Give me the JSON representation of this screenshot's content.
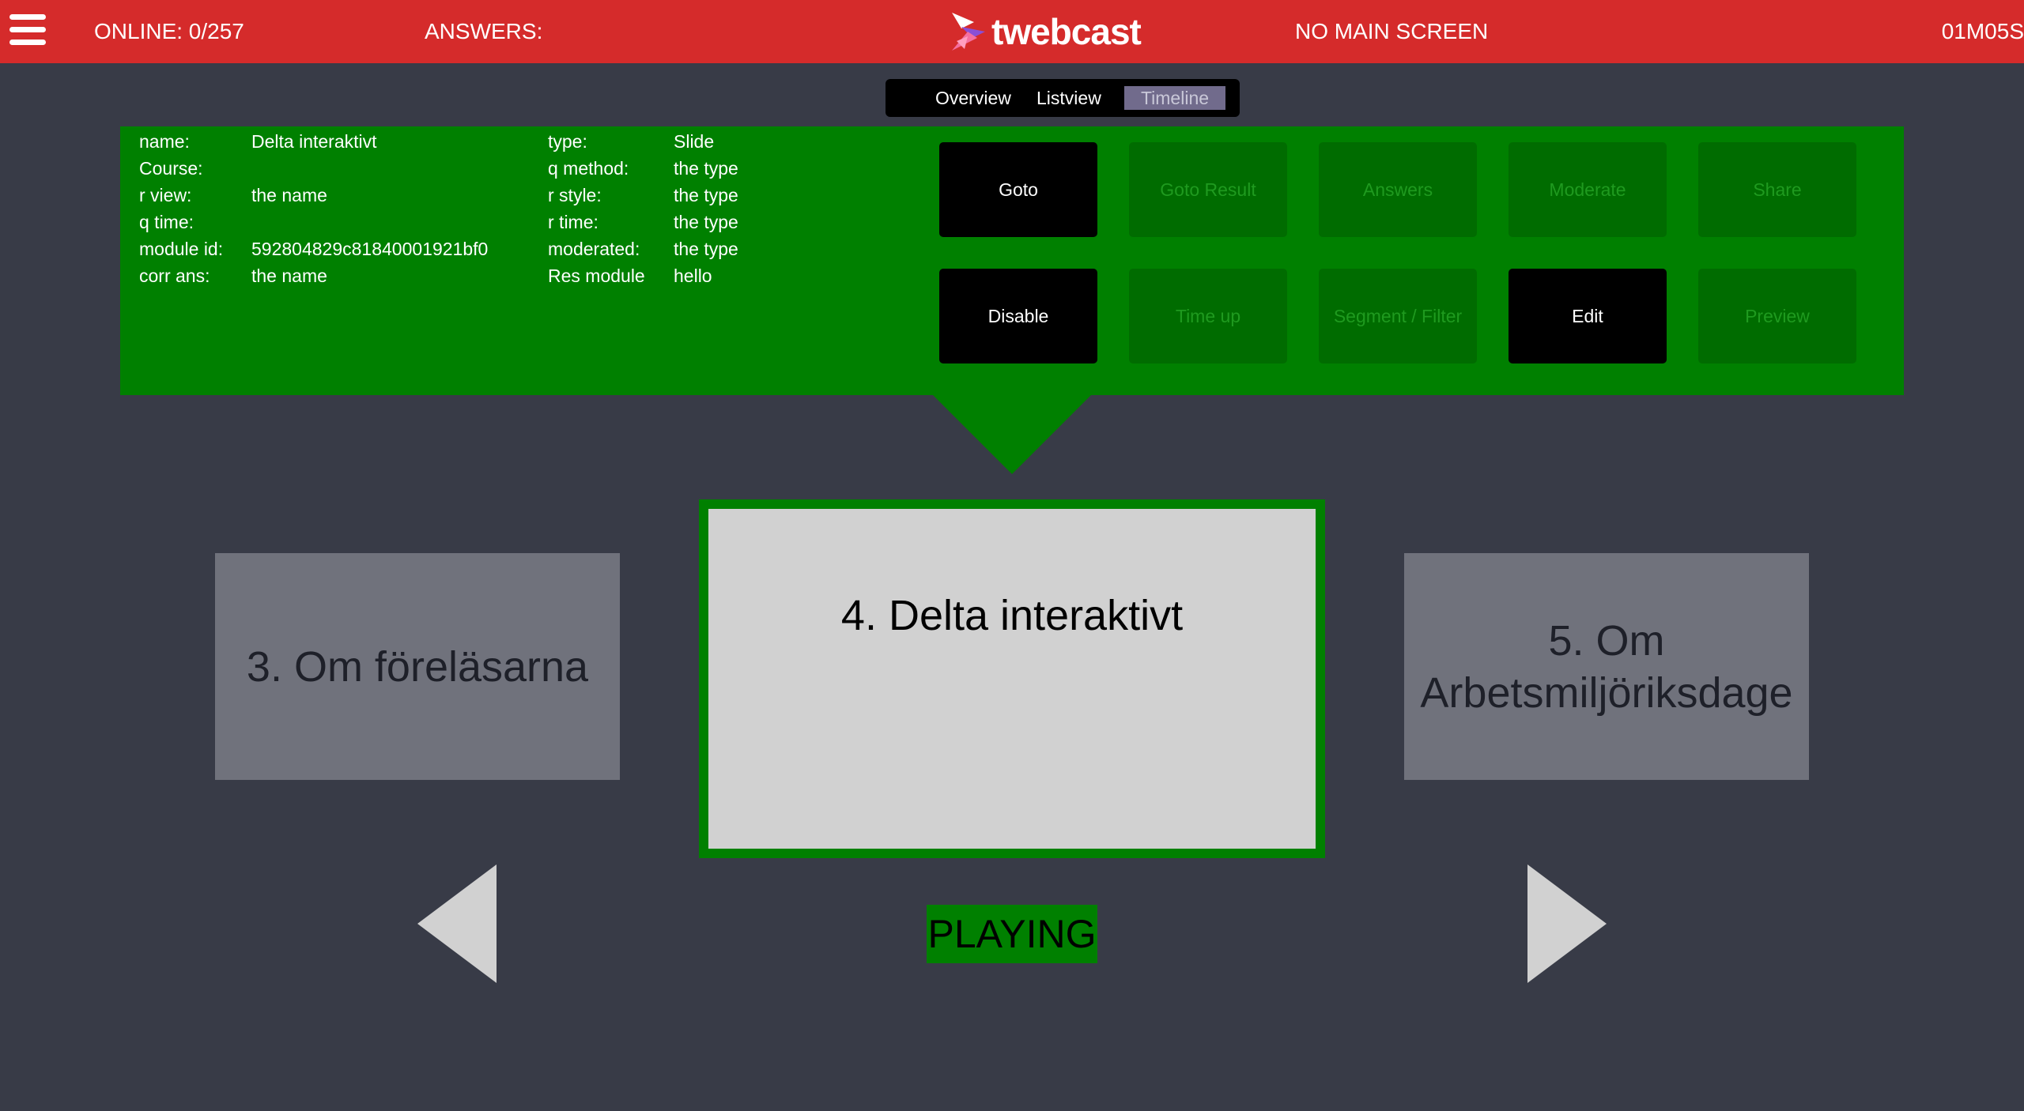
{
  "topbar": {
    "online": "ONLINE: 0/257",
    "answers": "ANSWERS:",
    "logo_text": "twebcast",
    "screen_status": "NO MAIN SCREEN",
    "timer": "01M05S"
  },
  "view_tabs": [
    {
      "label": "Overview"
    },
    {
      "label": "Listview"
    },
    {
      "label": "Timeline",
      "selected": true
    }
  ],
  "info": {
    "left": [
      {
        "key": "name:",
        "value": "Delta interaktivt"
      },
      {
        "key": "Course:",
        "value": ""
      },
      {
        "key": "r view:",
        "value": "the name"
      },
      {
        "key": "q time:",
        "value": ""
      },
      {
        "key": "module id:",
        "value": "592804829c81840001921bf0"
      },
      {
        "key": "corr ans:",
        "value": "the name"
      }
    ],
    "right": [
      {
        "key": "type:",
        "value": "Slide"
      },
      {
        "key": "q method:",
        "value": "the type"
      },
      {
        "key": "r style:",
        "value": "the type"
      },
      {
        "key": "r time:",
        "value": "the type"
      },
      {
        "key": "moderated:",
        "value": "the type"
      },
      {
        "key": "Res module",
        "value": "hello"
      }
    ]
  },
  "actions": {
    "row1": [
      {
        "label": "Goto",
        "enabled": true
      },
      {
        "label": "Goto Result",
        "enabled": false
      },
      {
        "label": "Answers",
        "enabled": false
      },
      {
        "label": "Moderate",
        "enabled": false
      },
      {
        "label": "Share",
        "enabled": false
      }
    ],
    "row2": [
      {
        "label": "Disable",
        "enabled": true
      },
      {
        "label": "Time up",
        "enabled": false
      },
      {
        "label": "Segment / Filter",
        "enabled": false
      },
      {
        "label": "Edit",
        "enabled": true
      },
      {
        "label": "Preview",
        "enabled": false
      }
    ]
  },
  "timeline": {
    "prev": {
      "title": "3. Om föreläsarna"
    },
    "current": {
      "title": "4. Delta interaktivt"
    },
    "next": {
      "title": "5. Om Arbetsmiljöriksdage"
    }
  },
  "status": "PLAYING",
  "colors": {
    "topbar": "#d52b2b",
    "background": "#383b47",
    "panel_green": "#008000",
    "inactive_button": "#006c00",
    "active_button": "#000000",
    "side_slide": "#70727c",
    "current_slide": "#d1d1d1",
    "tab_selected": "#716b8c"
  },
  "icons": {
    "menu": "hamburger-menu-icon",
    "logo": "twebcast-logo-icon",
    "prev": "triangle-left-icon",
    "next": "triangle-right-icon"
  }
}
